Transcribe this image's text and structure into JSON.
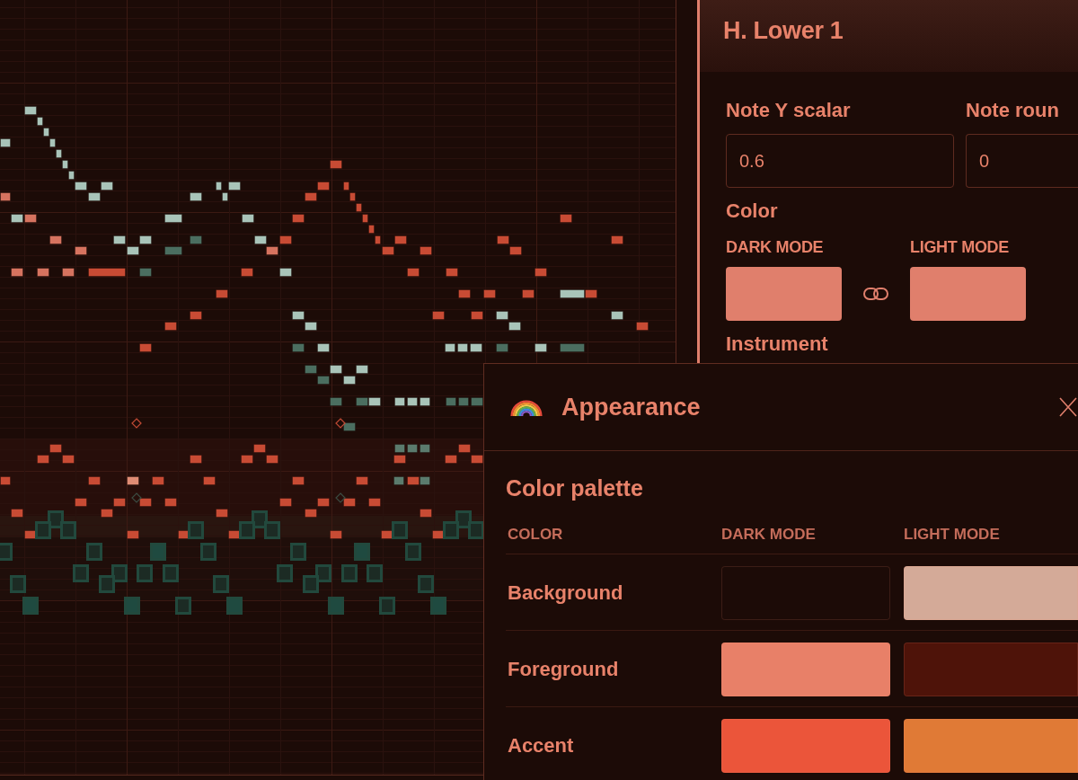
{
  "track_panel": {
    "title": "H. Lower 1",
    "fields": [
      {
        "label": "Note Y scalar",
        "value": "0.6"
      },
      {
        "label": "Note roun",
        "value": "0"
      }
    ],
    "color": {
      "label": "Color",
      "modes": [
        {
          "label": "DARK MODE",
          "color": "#e07f6c"
        },
        {
          "label": "LIGHT MODE",
          "color": "#e07f6c"
        }
      ],
      "linked": true
    },
    "instrument": {
      "label": "Instrument"
    }
  },
  "appearance_dialog": {
    "title": "Appearance",
    "section_title": "Color palette",
    "columns": [
      "COLOR",
      "DARK MODE",
      "LIGHT MODE"
    ],
    "rows": [
      {
        "name": "Background",
        "swatches": [
          {
            "color": "#1c0b07"
          },
          {
            "color": "#d4aa98"
          }
        ]
      },
      {
        "name": "Foreground",
        "swatches": [
          {
            "color": "#e88068"
          },
          {
            "color": "#4e1309"
          }
        ]
      },
      {
        "name": "Accent",
        "swatches": [
          {
            "color": "#eb553a"
          },
          {
            "color": "#e07a36"
          }
        ]
      }
    ]
  }
}
